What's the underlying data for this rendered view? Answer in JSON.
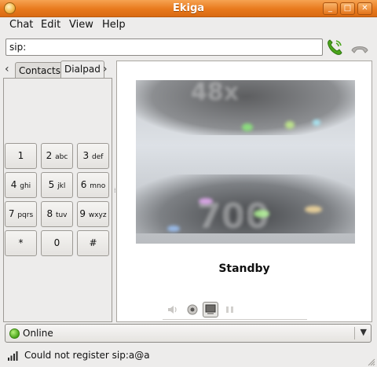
{
  "window": {
    "title": "Ekiga",
    "minimize": "_",
    "maximize": "□",
    "close": "✕"
  },
  "menu": [
    "Chat",
    "Edit",
    "View",
    "Help"
  ],
  "url": {
    "value": "sip:"
  },
  "icons": {
    "app": "ekiga-icon",
    "call": "phone-call-icon",
    "hangup": "phone-hangup-icon",
    "signal": "signal-strength-icon",
    "presence": "online-status-icon"
  },
  "tabs": {
    "prev": "‹",
    "next": "›",
    "contacts": "Contacts",
    "dialpad": "Dialpad"
  },
  "dialpad": [
    {
      "digit": "1",
      "letters": ""
    },
    {
      "digit": "2",
      "letters": "abc"
    },
    {
      "digit": "3",
      "letters": "def"
    },
    {
      "digit": "4",
      "letters": "ghi"
    },
    {
      "digit": "5",
      "letters": "jkl"
    },
    {
      "digit": "6",
      "letters": "mno"
    },
    {
      "digit": "7",
      "letters": "pqrs"
    },
    {
      "digit": "8",
      "letters": "tuv"
    },
    {
      "digit": "9",
      "letters": "wxyz"
    },
    {
      "digit": "*",
      "letters": ""
    },
    {
      "digit": "0",
      "letters": ""
    },
    {
      "digit": "#",
      "letters": ""
    }
  ],
  "main": {
    "status": "Standby"
  },
  "presence": {
    "label": "Online",
    "color": "#4aa51b"
  },
  "statusbar": {
    "message": "Could not register sip:a@a"
  },
  "colors": {
    "titlebar": "#e8791c",
    "call_green": "#3c9a1a"
  }
}
